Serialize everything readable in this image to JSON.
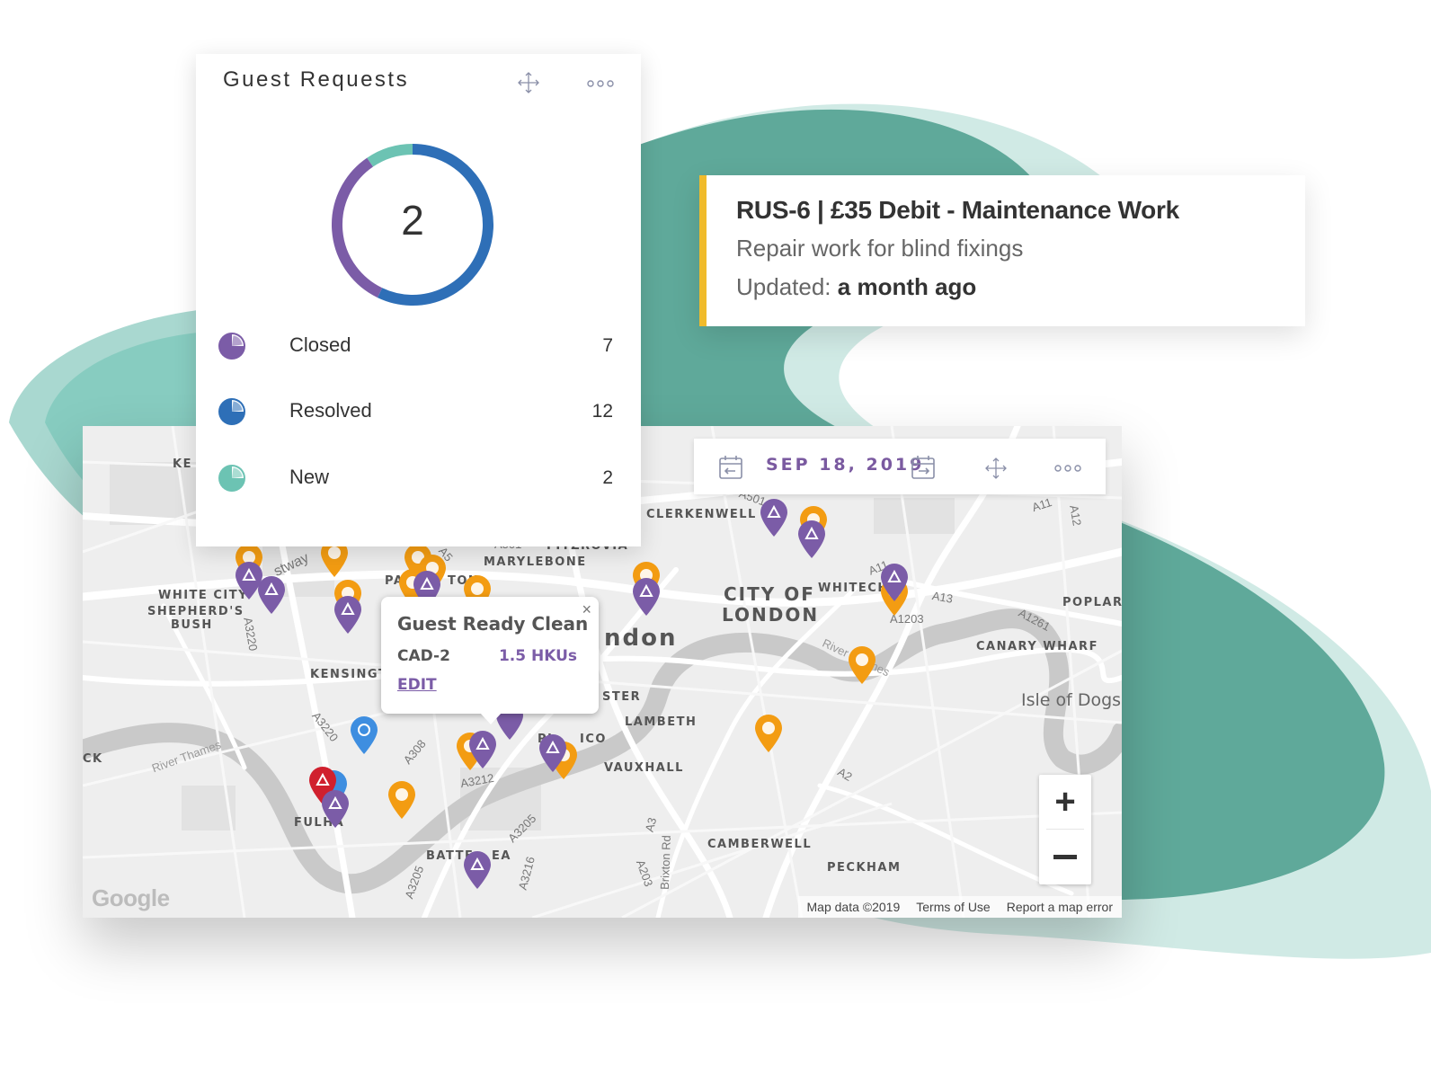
{
  "colors": {
    "teal": "#5fa99a",
    "teal_light": "#a9d8d0",
    "purple": "#7b5ca7",
    "blue": "#2e6fb7",
    "mint": "#6cc3b3",
    "orange": "#f39c12",
    "red": "#d0202e",
    "pin_blue": "#3e8ee0",
    "ticket_accent": "#f0bb2b"
  },
  "guest_requests": {
    "title": "Guest Requests",
    "center_value": "2",
    "legend": [
      {
        "label": "Closed",
        "value": "7",
        "color": "#7b5ca7"
      },
      {
        "label": "Resolved",
        "value": "12",
        "color": "#2e6fb7"
      },
      {
        "label": "New",
        "value": "2",
        "color": "#6cc3b3"
      }
    ],
    "icons": [
      "move-icon",
      "more-icon"
    ]
  },
  "ticket": {
    "title": "RUS-6 | £35 Debit - Maintenance Work",
    "description": "Repair work for blind fixings",
    "updated_label": "Updated:",
    "updated_value": "a month ago"
  },
  "map": {
    "date": "SEP 18, 2019",
    "info_window": {
      "title": "Guest Ready Clean",
      "code": "CAD-2",
      "amount": "1.5 HKUs",
      "action": "EDIT"
    },
    "areas": {
      "kensington_partial": "KE",
      "white_city": "WHITE CITY",
      "shepherds_bush_1": "SHEPHERD'S",
      "shepherds_bush_2": "BUSH",
      "kensington": "KENSINGT",
      "clerkenwell": "CLERKENWELL",
      "fitzrovia": "FITZROVIA",
      "marylebone": "MARYLEBONE",
      "paddington_a": "PA",
      "paddington_b": "TON",
      "city_1": "CITY OF",
      "city_2": "LONDON",
      "whitechapel": "WHITECHA",
      "london_partial": "ndon",
      "poplar": "POPLAR",
      "canary_wharf": "CANARY WHARF",
      "isle_of_dogs": "Isle of Dogs",
      "minster_partial": "STER",
      "lambeth": "LAMBETH",
      "vauxhall": "VAUXHALL",
      "pimlico_a": "PI",
      "pimlico_b": "ICO",
      "ck_partial": "CK",
      "fulham": "FULHA",
      "battersea_a": "BATTE",
      "battersea_b": "EA",
      "camberwell": "CAMBERWELL",
      "peckham": "PECKHAM"
    },
    "roads": {
      "a501": "A501",
      "a11_top": "A11",
      "a12": "A12",
      "a11_mid": "A11",
      "a13": "A13",
      "a1203": "A1203",
      "a1261": "A1261",
      "a5": "A5",
      "a501b": "A501",
      "westway": "stway",
      "a3220_top": "A3220",
      "a3220": "A3220",
      "a308": "A308",
      "a3212": "A3212",
      "a3205": "A3205",
      "a3205b": "A3205",
      "a3216": "A3216",
      "a203": "A203",
      "a3": "A3",
      "brixton": "Brixton Rd",
      "a2": "A2",
      "river_thames_w": "River Thames",
      "river_thames_e": "River Thames"
    },
    "google": "Google",
    "attribution": [
      "Map data ©2019",
      "Terms of Use",
      "Report a map error"
    ],
    "zoom_in": "+",
    "zoom_out": "−"
  }
}
